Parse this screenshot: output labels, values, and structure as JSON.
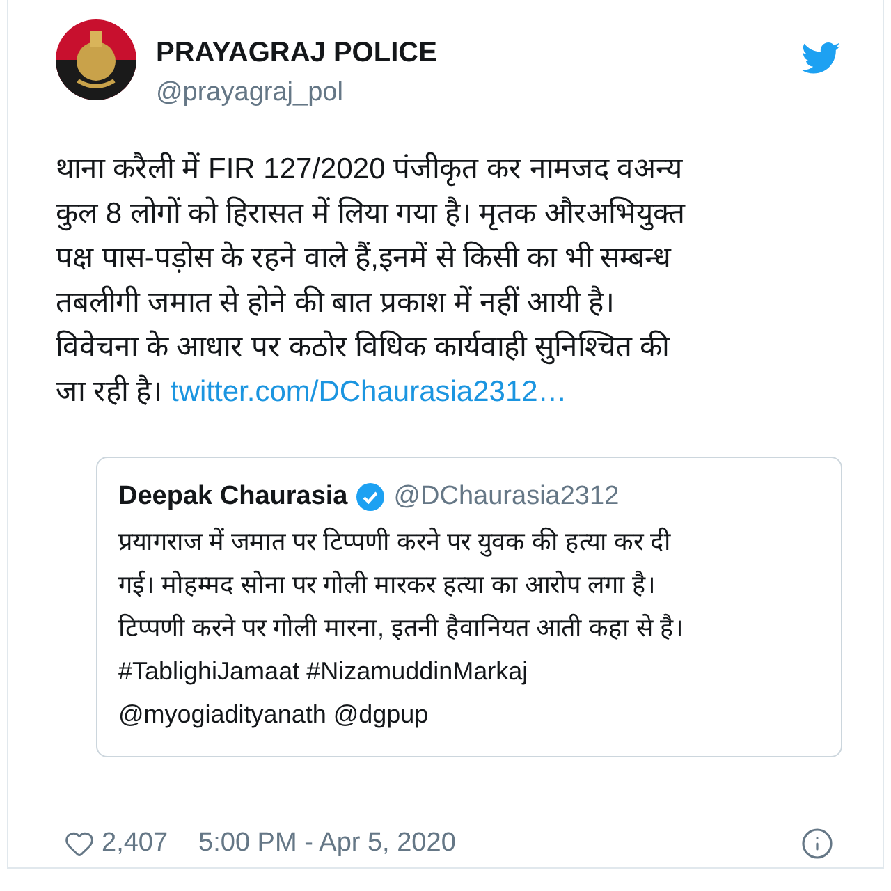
{
  "author": {
    "name": "PRAYAGRAJ POLICE",
    "handle": "@prayagraj_pol"
  },
  "body": {
    "lines": [
      "थाना करैली में FIR 127/2020 पंजीकृत कर नामजद वअन्य",
      "कुल 8 लोगों को हिरासत में लिया गया है। मृतक औरअभियुक्त",
      "पक्ष पास-पड़ोस के रहने वाले हैं,इनमें से किसी का भी सम्बन्ध",
      "तबलीगी जमात से होने की बात प्रकाश में नहीं आयी है।",
      "विवेचना के आधार पर कठोर विधिक कार्यवाही सुनिश्चित की",
      "जा रही है।"
    ],
    "link": "twitter.com/DChaurasia2312…"
  },
  "quoted": {
    "name": "Deepak Chaurasia",
    "verified": true,
    "handle": "@DChaurasia2312",
    "lines": [
      "प्रयागराज में जमात पर टिप्पणी करने पर युवक की हत्या कर दी",
      "गई। मोहम्मद सोना पर गोली मारकर हत्या का आरोप लगा है।",
      "टिप्पणी करने पर गोली मारना, इतनी हैवानियत आती कहा से है।",
      "#TablighiJamaat #NizamuddinMarkaj",
      "@myogiadityanath @dgpup"
    ]
  },
  "footer": {
    "likes": "2,407",
    "timestamp": "5:00 PM - Apr 5, 2020"
  }
}
